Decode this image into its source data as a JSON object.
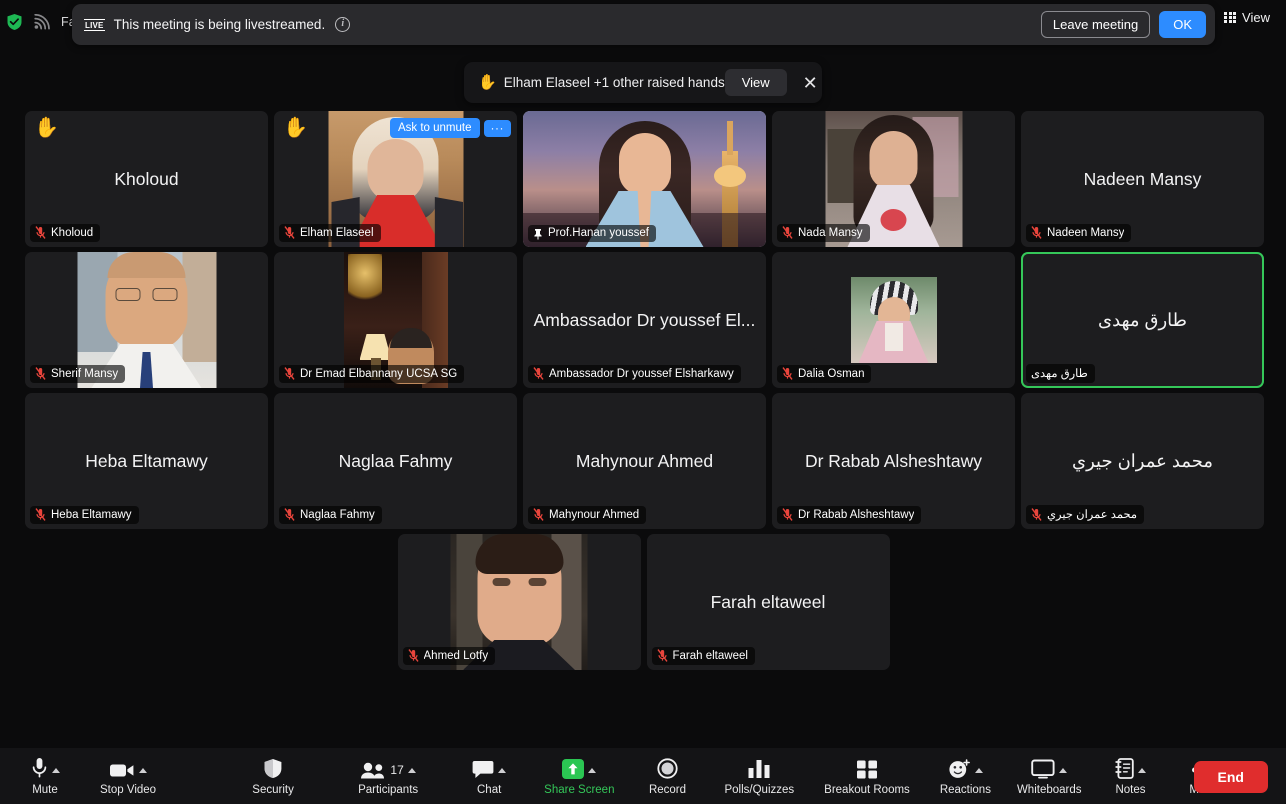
{
  "topbar": {
    "encryption_icon": "shield-check-icon",
    "broadcast_icon": "broadcast-icon",
    "recording_label": "Fa",
    "view_label": "View",
    "view_icon": "grid-view-icon"
  },
  "live_banner": {
    "chip": "LIVE",
    "message": "This meeting is being livestreamed.",
    "info_icon": "info-icon",
    "leave_label": "Leave meeting",
    "ok_label": "OK"
  },
  "hands_toast": {
    "hand_icon": "raised-hand-icon",
    "message": "Elham Elaseel +1 other raised hands",
    "view_label": "View",
    "close_icon": "close-icon"
  },
  "colors": {
    "accent_blue": "#2d8cff",
    "active_speaker_green": "#35c759",
    "share_screen_green": "#34c759",
    "end_red": "#e02d2d",
    "muted_mic_red": "#e8453c",
    "tile_bg": "#1d1d1f",
    "app_bg": "#0b0b0c"
  },
  "grid": {
    "rows": [
      [
        {
          "name": "Kholoud",
          "display_name": "Kholoud",
          "label": "Kholoud",
          "video": false,
          "muted": true,
          "hand_raised": true,
          "rtl": false,
          "active": false,
          "spotlight": false
        },
        {
          "name": "Elham Elaseel",
          "display_name": "",
          "label": "Elham Elaseel",
          "video": true,
          "video_style": "elham",
          "muted": true,
          "hand_raised": true,
          "rtl": false,
          "active": false,
          "spotlight": false,
          "ask_to_unmute": "Ask to unmute",
          "more_label": "···"
        },
        {
          "name": "Prof.Hanan youssef",
          "display_name": "",
          "label": "Prof.Hanan youssef",
          "video": true,
          "video_style": "hanan",
          "muted": false,
          "pinned": true,
          "hand_raised": false,
          "rtl": false,
          "active": false,
          "spotlight": true
        },
        {
          "name": "Nada Mansy",
          "display_name": "",
          "label": "Nada Mansy",
          "video": true,
          "video_style": "nada",
          "muted": true,
          "hand_raised": false,
          "rtl": false,
          "active": false,
          "spotlight": false
        },
        {
          "name": "Nadeen Mansy",
          "display_name": "Nadeen Mansy",
          "label": "Nadeen Mansy",
          "video": false,
          "muted": true,
          "hand_raised": false,
          "rtl": false,
          "active": false,
          "spotlight": false
        }
      ],
      [
        {
          "name": "Sherif Mansy",
          "display_name": "",
          "label": "Sherif Mansy",
          "video": true,
          "video_style": "sherif",
          "muted": true,
          "hand_raised": false,
          "rtl": false,
          "active": false,
          "spotlight": false
        },
        {
          "name": "Dr Emad Elbannany UCSA SG",
          "display_name": "",
          "label": "Dr Emad Elbannany UCSA SG",
          "video": true,
          "video_style": "emad",
          "muted": true,
          "hand_raised": false,
          "rtl": false,
          "active": false,
          "spotlight": false
        },
        {
          "name": "Ambassador Dr youssef Elsharkawy",
          "display_name": "Ambassador Dr youssef El...",
          "label": "Ambassador Dr youssef Elsharkawy",
          "video": false,
          "muted": true,
          "hand_raised": false,
          "rtl": false,
          "active": false,
          "spotlight": false
        },
        {
          "name": "Dalia Osman",
          "display_name": "",
          "label": "Dalia Osman",
          "video": true,
          "video_style": "dalia",
          "muted": true,
          "hand_raised": false,
          "rtl": false,
          "active": false,
          "spotlight": false
        },
        {
          "name": "طارق مهدى",
          "display_name": "طارق  مهدى",
          "label": "طارق  مهدى",
          "video": false,
          "muted": false,
          "hand_raised": false,
          "rtl": true,
          "active": true,
          "spotlight": false
        }
      ],
      [
        {
          "name": "Heba Eltamawy",
          "display_name": "Heba Eltamawy",
          "label": "Heba Eltamawy",
          "video": false,
          "muted": true,
          "hand_raised": false,
          "rtl": false,
          "active": false,
          "spotlight": false
        },
        {
          "name": "Naglaa Fahmy",
          "display_name": "Naglaa Fahmy",
          "label": "Naglaa Fahmy",
          "video": false,
          "muted": true,
          "hand_raised": false,
          "rtl": false,
          "active": false,
          "spotlight": false
        },
        {
          "name": "Mahynour Ahmed",
          "display_name": "Mahynour Ahmed",
          "label": "Mahynour Ahmed",
          "video": false,
          "muted": true,
          "hand_raised": false,
          "rtl": false,
          "active": false,
          "spotlight": false
        },
        {
          "name": "Dr Rabab Alsheshtawy",
          "display_name": "Dr Rabab Alsheshtawy",
          "label": "Dr Rabab Alsheshtawy",
          "video": false,
          "muted": true,
          "hand_raised": false,
          "rtl": false,
          "active": false,
          "spotlight": false
        },
        {
          "name": "محمد عمران جيري",
          "display_name": "محمد عمران جيري",
          "label": "محمد عمران جيري",
          "video": false,
          "muted": true,
          "hand_raised": false,
          "rtl": true,
          "active": false,
          "spotlight": false
        }
      ],
      [
        {
          "name": "Ahmed Lotfy",
          "display_name": "",
          "label": "Ahmed Lotfy",
          "video": true,
          "video_style": "ahmed",
          "muted": true,
          "hand_raised": false,
          "rtl": false,
          "active": false,
          "spotlight": false
        },
        {
          "name": "Farah eltaweel",
          "display_name": "Farah eltaweel",
          "label": "Farah eltaweel",
          "video": false,
          "muted": true,
          "hand_raised": false,
          "rtl": false,
          "active": false,
          "spotlight": false
        }
      ]
    ]
  },
  "toolbar": {
    "mute_label": "Mute",
    "stop_video_label": "Stop Video",
    "security_label": "Security",
    "participants_label": "Participants",
    "participants_count": "17",
    "chat_label": "Chat",
    "share_screen_label": "Share Screen",
    "record_label": "Record",
    "polls_label": "Polls/Quizzes",
    "breakout_label": "Breakout Rooms",
    "reactions_label": "Reactions",
    "whiteboards_label": "Whiteboards",
    "notes_label": "Notes",
    "more_label": "More",
    "end_label": "End"
  }
}
